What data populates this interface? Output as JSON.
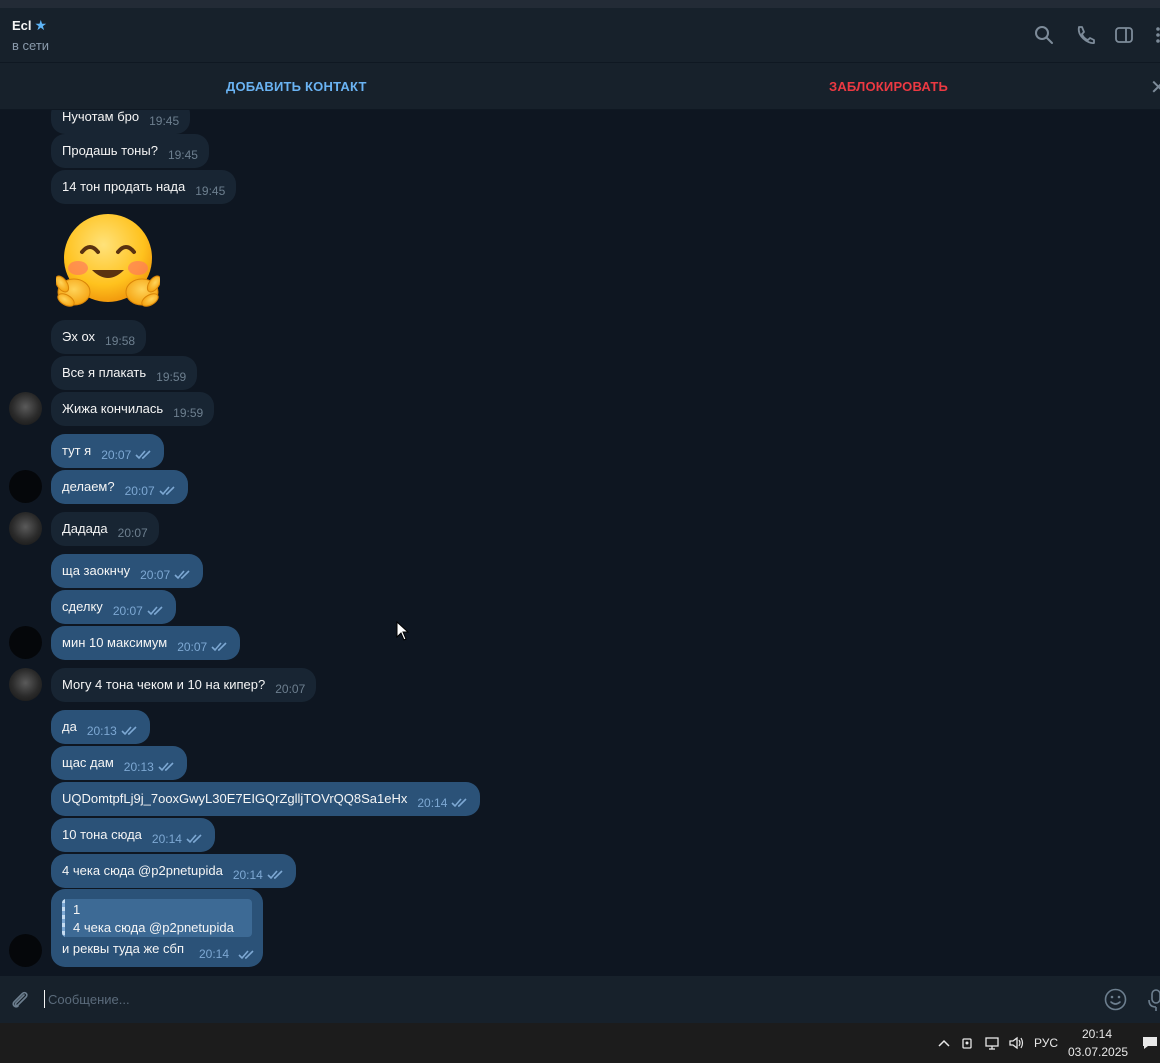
{
  "header": {
    "contact_name": "Ecl",
    "star_icon": "star-icon",
    "status": "в сети",
    "icons": [
      "search-icon",
      "phone-icon",
      "sidebar-toggle-icon",
      "more-icon"
    ]
  },
  "actions": {
    "add_contact": "ДОБАВИТЬ КОНТАКТ",
    "block": "ЗАБЛОКИРОВАТЬ",
    "close_icon": "close-icon"
  },
  "messages": [
    {
      "dir": "in",
      "text": "Нучотам бро",
      "time": "19:45"
    },
    {
      "dir": "in",
      "text": "Продашь тоны?",
      "time": "19:45"
    },
    {
      "dir": "in",
      "text": "14 тон продать нада",
      "time": "19:45"
    },
    {
      "dir": "in",
      "text": "Эх ох",
      "time": "19:58"
    },
    {
      "dir": "in",
      "text": "Все я плакать",
      "time": "19:59"
    },
    {
      "dir": "in",
      "text": "Жижа кончилась",
      "time": "19:59"
    },
    {
      "dir": "out",
      "text": "тут я",
      "time": "20:07"
    },
    {
      "dir": "out",
      "text": "делаем?",
      "time": "20:07"
    },
    {
      "dir": "in",
      "text": "Дадада",
      "time": "20:07"
    },
    {
      "dir": "out",
      "text": "ща заокнчу",
      "time": "20:07"
    },
    {
      "dir": "out",
      "text": "сделку",
      "time": "20:07"
    },
    {
      "dir": "out",
      "text": "мин 10 максимум",
      "time": "20:07"
    },
    {
      "dir": "in",
      "text": "Могу 4 тона чеком и 10 на кипер?",
      "time": "20:07"
    },
    {
      "dir": "out",
      "text": "да",
      "time": "20:13"
    },
    {
      "dir": "out",
      "text": "щас дам",
      "time": "20:13"
    },
    {
      "dir": "out",
      "text": "UQDomtpfLj9j_7ooxGwyL30E7EIGQrZglljTOVrQQ8Sa1eHx",
      "time": "20:14"
    },
    {
      "dir": "out",
      "text": "10 тона сюда",
      "time": "20:14"
    },
    {
      "dir": "out",
      "text": "4 чека сюда @p2pnetupida",
      "time": "20:14"
    }
  ],
  "reply_message": {
    "quote_author": "1",
    "quote_text": "4 чека сюда @p2pnetupida",
    "text": "и реквы туда же сбп",
    "time": "20:14"
  },
  "sticker": "hugging-face-emoji",
  "composer": {
    "placeholder": "Сообщение..."
  },
  "taskbar": {
    "language": "РУС",
    "time": "20:14",
    "date": "03.07.2025"
  }
}
